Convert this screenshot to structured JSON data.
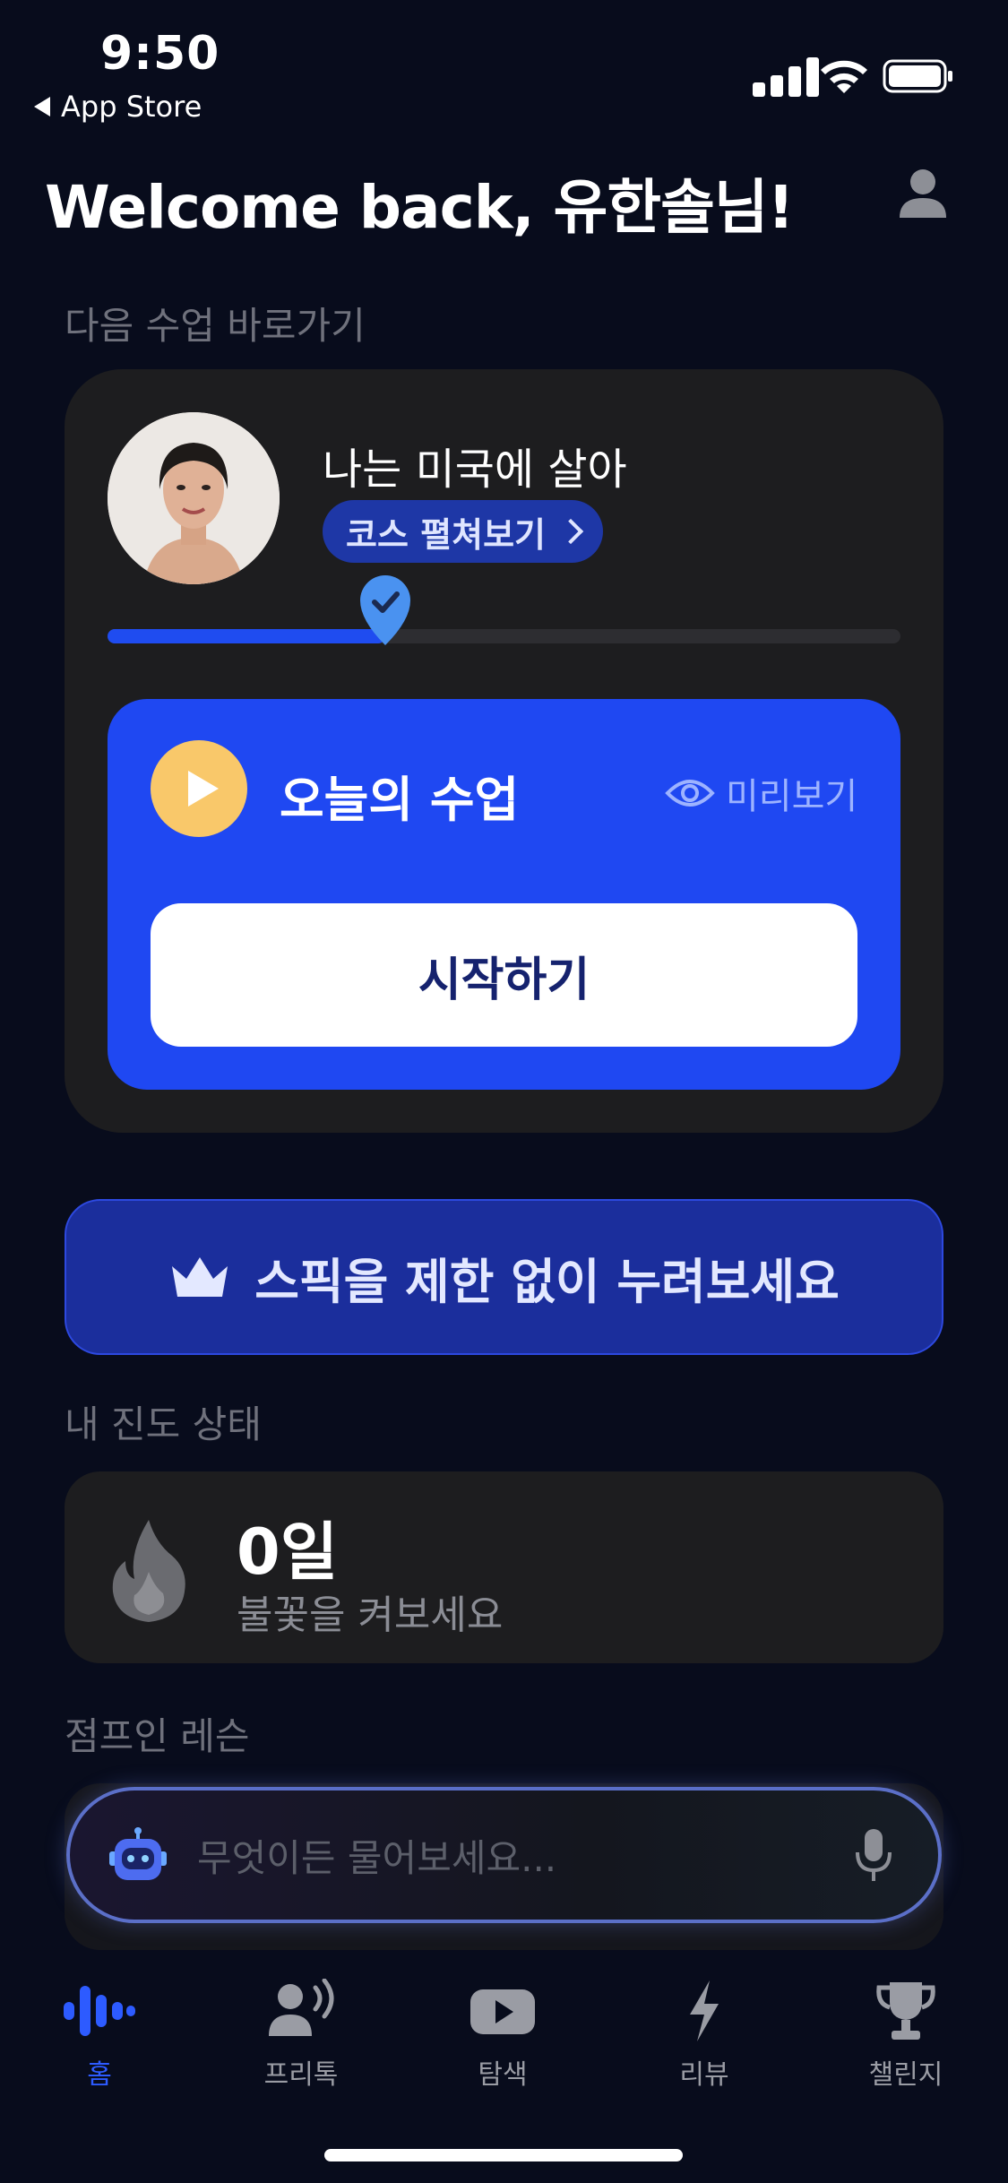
{
  "status_bar": {
    "time": "9:50",
    "back_label": "App Store"
  },
  "header": {
    "welcome": "Welcome back, 유한솔님!"
  },
  "next_class": {
    "section_title": "다음 수업 바로가기",
    "course_title": "나는 미국에 살아",
    "course_button": "코스 펼쳐보기",
    "progress": 0.35,
    "today_label": "오늘의 수업",
    "preview_label": "미리보기",
    "start_button": "시작하기"
  },
  "promo": {
    "label": "스픽을 제한 없이 누려보세요"
  },
  "progress_section": {
    "section_title": "내 진도 상태",
    "days": "0일",
    "subtitle": "불꽃을 켜보세요"
  },
  "jump_in": {
    "section_title": "점프인 레슨",
    "placeholder": "무엇이든 물어보세요..."
  },
  "tab_bar": {
    "items": [
      {
        "label": "홈",
        "active": true
      },
      {
        "label": "프리톡",
        "active": false
      },
      {
        "label": "탐색",
        "active": false
      },
      {
        "label": "리뷰",
        "active": false
      },
      {
        "label": "챌린지",
        "active": false
      }
    ]
  },
  "colors": {
    "background": "#080c1c",
    "accent": "#1f48f2",
    "card": "#1d1d1f",
    "play_yellow": "#f9c86a"
  }
}
